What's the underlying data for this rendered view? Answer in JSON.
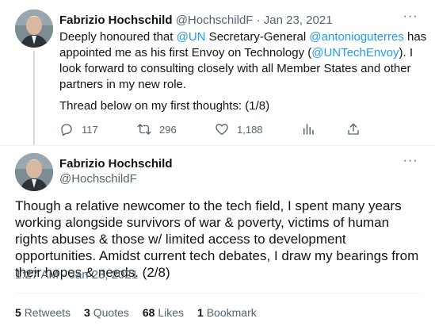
{
  "tweet1": {
    "name": "Fabrizio Hochschild",
    "handle": "@HochschildF",
    "separator": "·",
    "date": "Jan 23, 2021",
    "more_label": "···",
    "text_part1": "Deeply honoured that ",
    "mention_un": "@UN",
    "text_part2": " Secretary-General ",
    "mention_sg": "@antonioguterres",
    "text_part3": " has appointed me as his first Envoy on Technology (",
    "mention_envoy": "@UNTechEnvoy",
    "text_part4": "). I look forward to consulting closely with all Member States and other partners in my new role.",
    "thread_note": "Thread below on my first thoughts: (1/8)",
    "reply_count": "117",
    "retweet_count": "296",
    "like_count": "1,188",
    "icons": [
      "reply-icon",
      "retweet-icon",
      "like-icon",
      "views-icon",
      "share-icon"
    ]
  },
  "tweet2": {
    "name": "Fabrizio Hochschild",
    "handle": "@HochschildF",
    "more_label": "···",
    "text": "Though a relative newcomer to the tech field, I spent many years working alongside survivors of war & poverty, victims of human rights abuses & those w/ limited access to development opportunities. Amidst current tech debates, I draw my bearings from their hopes & needs. (2/8)",
    "timestamp": "1:27 AM · Jan 23, 2021",
    "stats": {
      "retweets_count": "5",
      "retweets_label": "Retweets",
      "quotes_count": "3",
      "quotes_label": "Quotes",
      "likes_count": "68",
      "likes_label": "Likes",
      "bookmarks_count": "1",
      "bookmarks_label": "Bookmark"
    }
  },
  "colors": {
    "link": "#1d9bf0",
    "muted": "#536471",
    "text": "#0f1419",
    "thread_line": "#cfd9de"
  }
}
